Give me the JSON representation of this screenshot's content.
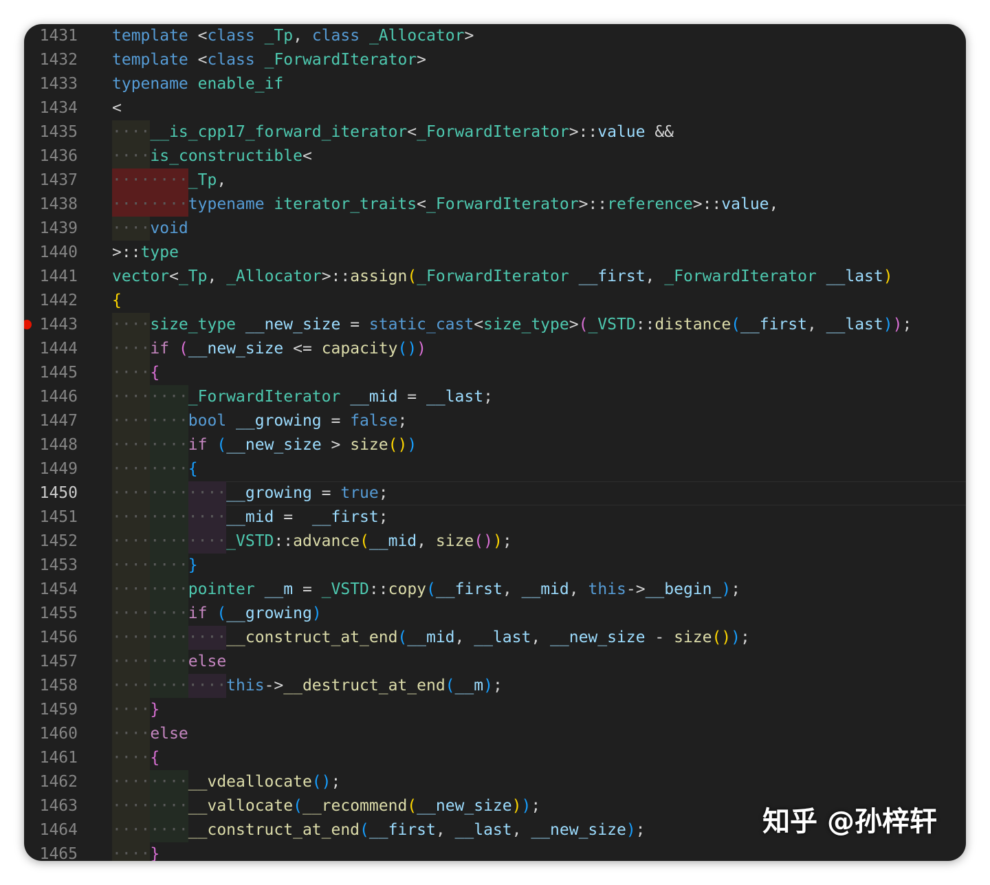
{
  "editor": {
    "active_line": 1450,
    "breakpoint_line": 1443,
    "colors": {
      "background": "#1f1f1f",
      "line_number": "#858585",
      "keyword": "#569cd6",
      "control": "#c586c0",
      "type": "#4ec9b0",
      "function": "#dcdcaa",
      "variable": "#9cdcfe",
      "breakpoint": "#e51400"
    },
    "lines": [
      {
        "n": "1431",
        "indent": 0,
        "tokens": [
          [
            "kw",
            "template"
          ],
          [
            "op",
            " <"
          ],
          [
            "kw",
            "class"
          ],
          [
            "op",
            " "
          ],
          [
            "ty",
            "_Tp"
          ],
          [
            "op",
            ", "
          ],
          [
            "kw",
            "class"
          ],
          [
            "op",
            " "
          ],
          [
            "ty",
            "_Allocator"
          ],
          [
            "op",
            ">"
          ]
        ]
      },
      {
        "n": "1432",
        "indent": 0,
        "tokens": [
          [
            "kw",
            "template"
          ],
          [
            "op",
            " <"
          ],
          [
            "kw",
            "class"
          ],
          [
            "op",
            " "
          ],
          [
            "ty",
            "_ForwardIterator"
          ],
          [
            "op",
            ">"
          ]
        ]
      },
      {
        "n": "1433",
        "indent": 0,
        "tokens": [
          [
            "kw",
            "typename"
          ],
          [
            "op",
            " "
          ],
          [
            "ty",
            "enable_if"
          ]
        ]
      },
      {
        "n": "1434",
        "indent": 0,
        "tokens": [
          [
            "op",
            "<"
          ]
        ]
      },
      {
        "n": "1435",
        "indent": 1,
        "tokens": [
          [
            "ty",
            "__is_cpp17_forward_iterator"
          ],
          [
            "op",
            "<"
          ],
          [
            "ty",
            "_ForwardIterator"
          ],
          [
            "op",
            ">::"
          ],
          [
            "var",
            "value"
          ],
          [
            "op",
            " &&"
          ]
        ]
      },
      {
        "n": "1436",
        "indent": 1,
        "tokens": [
          [
            "ty",
            "is_constructible"
          ],
          [
            "op",
            "<"
          ]
        ]
      },
      {
        "n": "1437",
        "indent": 2,
        "err": true,
        "tokens": [
          [
            "ty",
            "_Tp"
          ],
          [
            "op",
            ","
          ]
        ]
      },
      {
        "n": "1438",
        "indent": 2,
        "err": true,
        "tokens": [
          [
            "kw",
            "typename"
          ],
          [
            "op",
            " "
          ],
          [
            "ty",
            "iterator_traits"
          ],
          [
            "op",
            "<"
          ],
          [
            "ty",
            "_ForwardIterator"
          ],
          [
            "op",
            ">::"
          ],
          [
            "ty",
            "reference"
          ],
          [
            "op",
            ">::"
          ],
          [
            "var",
            "value"
          ],
          [
            "op",
            ","
          ]
        ]
      },
      {
        "n": "1439",
        "indent": 1,
        "tokens": [
          [
            "kw",
            "void"
          ]
        ]
      },
      {
        "n": "1440",
        "indent": 0,
        "tokens": [
          [
            "op",
            ">::"
          ],
          [
            "ty",
            "type"
          ]
        ]
      },
      {
        "n": "1441",
        "indent": 0,
        "tokens": [
          [
            "ty",
            "vector"
          ],
          [
            "op",
            "<"
          ],
          [
            "ty",
            "_Tp"
          ],
          [
            "op",
            ", "
          ],
          [
            "ty",
            "_Allocator"
          ],
          [
            "op",
            ">::"
          ],
          [
            "fn",
            "assign"
          ],
          [
            "p1",
            "("
          ],
          [
            "ty",
            "_ForwardIterator"
          ],
          [
            "op",
            " "
          ],
          [
            "var",
            "__first"
          ],
          [
            "op",
            ", "
          ],
          [
            "ty",
            "_ForwardIterator"
          ],
          [
            "op",
            " "
          ],
          [
            "var",
            "__last"
          ],
          [
            "p1",
            ")"
          ]
        ]
      },
      {
        "n": "1442",
        "indent": 0,
        "tokens": [
          [
            "p1",
            "{"
          ]
        ]
      },
      {
        "n": "1443",
        "indent": 1,
        "tokens": [
          [
            "ty",
            "size_type"
          ],
          [
            "op",
            " "
          ],
          [
            "var",
            "__new_size"
          ],
          [
            "op",
            " = "
          ],
          [
            "kw",
            "static_cast"
          ],
          [
            "op",
            "<"
          ],
          [
            "ty",
            "size_type"
          ],
          [
            "op",
            ">"
          ],
          [
            "p2",
            "("
          ],
          [
            "ty",
            "_VSTD"
          ],
          [
            "op",
            "::"
          ],
          [
            "fn",
            "distance"
          ],
          [
            "p3",
            "("
          ],
          [
            "var",
            "__first"
          ],
          [
            "op",
            ", "
          ],
          [
            "var",
            "__last"
          ],
          [
            "p3",
            ")"
          ],
          [
            "p2",
            ")"
          ],
          [
            "op",
            ";"
          ]
        ]
      },
      {
        "n": "1444",
        "indent": 1,
        "tokens": [
          [
            "ctl",
            "if"
          ],
          [
            "op",
            " "
          ],
          [
            "p2",
            "("
          ],
          [
            "var",
            "__new_size"
          ],
          [
            "op",
            " <= "
          ],
          [
            "fn",
            "capacity"
          ],
          [
            "p3",
            "()"
          ],
          [
            "p2",
            ")"
          ]
        ]
      },
      {
        "n": "1445",
        "indent": 1,
        "tokens": [
          [
            "p2",
            "{"
          ]
        ]
      },
      {
        "n": "1446",
        "indent": 2,
        "tokens": [
          [
            "ty",
            "_ForwardIterator"
          ],
          [
            "op",
            " "
          ],
          [
            "var",
            "__mid"
          ],
          [
            "op",
            " = "
          ],
          [
            "var",
            "__last"
          ],
          [
            "op",
            ";"
          ]
        ]
      },
      {
        "n": "1447",
        "indent": 2,
        "tokens": [
          [
            "kw",
            "bool"
          ],
          [
            "op",
            " "
          ],
          [
            "var",
            "__growing"
          ],
          [
            "op",
            " = "
          ],
          [
            "kw",
            "false"
          ],
          [
            "op",
            ";"
          ]
        ]
      },
      {
        "n": "1448",
        "indent": 2,
        "tokens": [
          [
            "ctl",
            "if"
          ],
          [
            "op",
            " "
          ],
          [
            "p3",
            "("
          ],
          [
            "var",
            "__new_size"
          ],
          [
            "op",
            " > "
          ],
          [
            "fn",
            "size"
          ],
          [
            "p1",
            "()"
          ],
          [
            "p3",
            ")"
          ]
        ]
      },
      {
        "n": "1449",
        "indent": 2,
        "tokens": [
          [
            "p3",
            "{"
          ]
        ]
      },
      {
        "n": "1450",
        "indent": 3,
        "tokens": [
          [
            "var",
            "__growing"
          ],
          [
            "op",
            " = "
          ],
          [
            "kw",
            "true"
          ],
          [
            "op",
            ";"
          ]
        ]
      },
      {
        "n": "1451",
        "indent": 3,
        "tokens": [
          [
            "var",
            "__mid"
          ],
          [
            "op",
            " =  "
          ],
          [
            "var",
            "__first"
          ],
          [
            "op",
            ";"
          ]
        ]
      },
      {
        "n": "1452",
        "indent": 3,
        "tokens": [
          [
            "ty",
            "_VSTD"
          ],
          [
            "op",
            "::"
          ],
          [
            "fn",
            "advance"
          ],
          [
            "p1",
            "("
          ],
          [
            "var",
            "__mid"
          ],
          [
            "op",
            ", "
          ],
          [
            "fn",
            "size"
          ],
          [
            "p2",
            "()"
          ],
          [
            "p1",
            ")"
          ],
          [
            "op",
            ";"
          ]
        ]
      },
      {
        "n": "1453",
        "indent": 2,
        "tokens": [
          [
            "p3",
            "}"
          ]
        ]
      },
      {
        "n": "1454",
        "indent": 2,
        "tokens": [
          [
            "ty",
            "pointer"
          ],
          [
            "op",
            " "
          ],
          [
            "var",
            "__m"
          ],
          [
            "op",
            " = "
          ],
          [
            "ty",
            "_VSTD"
          ],
          [
            "op",
            "::"
          ],
          [
            "fn",
            "copy"
          ],
          [
            "p3",
            "("
          ],
          [
            "var",
            "__first"
          ],
          [
            "op",
            ", "
          ],
          [
            "var",
            "__mid"
          ],
          [
            "op",
            ", "
          ],
          [
            "kw",
            "this"
          ],
          [
            "op",
            "->"
          ],
          [
            "var",
            "__begin_"
          ],
          [
            "p3",
            ")"
          ],
          [
            "op",
            ";"
          ]
        ]
      },
      {
        "n": "1455",
        "indent": 2,
        "tokens": [
          [
            "ctl",
            "if"
          ],
          [
            "op",
            " "
          ],
          [
            "p3",
            "("
          ],
          [
            "var",
            "__growing"
          ],
          [
            "p3",
            ")"
          ]
        ]
      },
      {
        "n": "1456",
        "indent": 3,
        "tokens": [
          [
            "fn",
            "__construct_at_end"
          ],
          [
            "p3",
            "("
          ],
          [
            "var",
            "__mid"
          ],
          [
            "op",
            ", "
          ],
          [
            "var",
            "__last"
          ],
          [
            "op",
            ", "
          ],
          [
            "var",
            "__new_size"
          ],
          [
            "op",
            " - "
          ],
          [
            "fn",
            "size"
          ],
          [
            "p1",
            "()"
          ],
          [
            "p3",
            ")"
          ],
          [
            "op",
            ";"
          ]
        ]
      },
      {
        "n": "1457",
        "indent": 2,
        "tokens": [
          [
            "ctl",
            "else"
          ]
        ]
      },
      {
        "n": "1458",
        "indent": 3,
        "tokens": [
          [
            "kw",
            "this"
          ],
          [
            "op",
            "->"
          ],
          [
            "fn",
            "__destruct_at_end"
          ],
          [
            "p3",
            "("
          ],
          [
            "var",
            "__m"
          ],
          [
            "p3",
            ")"
          ],
          [
            "op",
            ";"
          ]
        ]
      },
      {
        "n": "1459",
        "indent": 1,
        "tokens": [
          [
            "p2",
            "}"
          ]
        ]
      },
      {
        "n": "1460",
        "indent": 1,
        "tokens": [
          [
            "ctl",
            "else"
          ]
        ]
      },
      {
        "n": "1461",
        "indent": 1,
        "tokens": [
          [
            "p2",
            "{"
          ]
        ]
      },
      {
        "n": "1462",
        "indent": 2,
        "tokens": [
          [
            "fn",
            "__vdeallocate"
          ],
          [
            "p3",
            "()"
          ],
          [
            "op",
            ";"
          ]
        ]
      },
      {
        "n": "1463",
        "indent": 2,
        "tokens": [
          [
            "fn",
            "__vallocate"
          ],
          [
            "p3",
            "("
          ],
          [
            "fn",
            "__recommend"
          ],
          [
            "p1",
            "("
          ],
          [
            "var",
            "__new_size"
          ],
          [
            "p1",
            ")"
          ],
          [
            "p3",
            ")"
          ],
          [
            "op",
            ";"
          ]
        ]
      },
      {
        "n": "1464",
        "indent": 2,
        "tokens": [
          [
            "fn",
            "__construct_at_end"
          ],
          [
            "p3",
            "("
          ],
          [
            "var",
            "__first"
          ],
          [
            "op",
            ", "
          ],
          [
            "var",
            "__last"
          ],
          [
            "op",
            ", "
          ],
          [
            "var",
            "__new_size"
          ],
          [
            "p3",
            ")"
          ],
          [
            "op",
            ";"
          ]
        ]
      },
      {
        "n": "1465",
        "indent": 1,
        "tokens": [
          [
            "p2",
            "}"
          ]
        ]
      }
    ]
  },
  "watermark": "知乎 @孙梓轩"
}
